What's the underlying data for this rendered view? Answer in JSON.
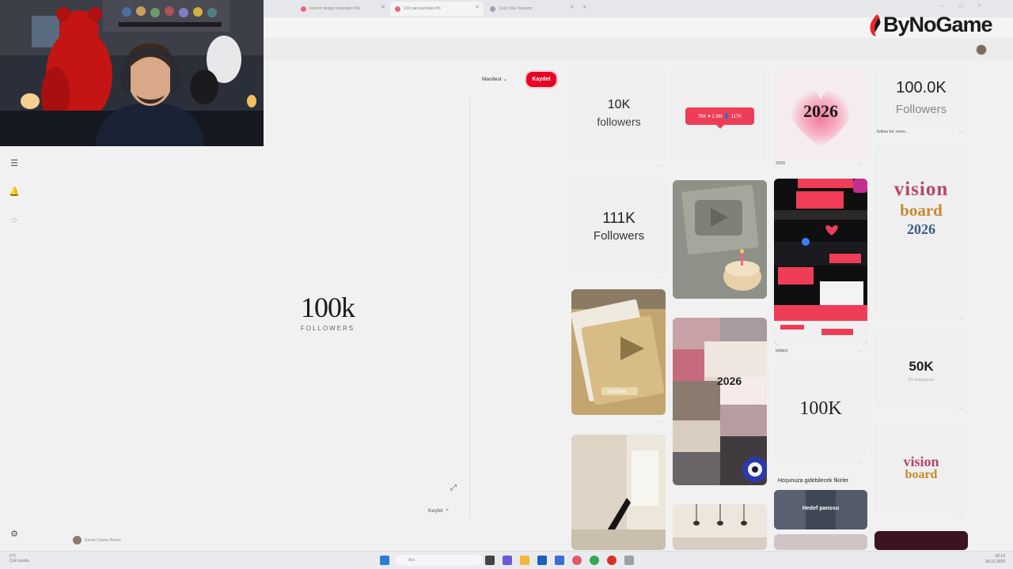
{
  "browser": {
    "tabs": [
      {
        "title": "Interior design inspiration Mo",
        "active": false,
        "icon": "pinterest-icon"
      },
      {
        "title": "100 panosundaki Pin",
        "active": true,
        "icon": "pinterest-icon"
      },
      {
        "title": "Cozy Oda Tasarımı",
        "active": false,
        "icon": "page-icon"
      }
    ],
    "new_tab": "+"
  },
  "logo": {
    "text": "ByNoGame",
    "flame_color": "#e8262b"
  },
  "pin": {
    "big_text": "100k",
    "sub_text": "FOLLOWERS",
    "board_dropdown": "Manifest ⌄",
    "save_label": "Kaydet",
    "explore_label": "Keşfet",
    "save_color": "#e60023"
  },
  "sidebar": {
    "profile_name": "Kevin Camo Perez"
  },
  "grid": {
    "card_10k": {
      "num": "10K",
      "label": "followers"
    },
    "card_badge": {
      "text": "78K ♥ 2.3M 👤 117K"
    },
    "card_2026": {
      "text": "2026",
      "caption": "2026"
    },
    "card_100k_followers": {
      "num": "100.0K",
      "label": "Followers",
      "caption": "follow for more.."
    },
    "card_111k": {
      "num": "111K",
      "label": "Followers"
    },
    "card_vision": {
      "line1": "vision",
      "line2": "board",
      "line3": "2026"
    },
    "card_collage_caption": "takipçi",
    "card_50k": {
      "num": "50K",
      "label": "On Instagram"
    },
    "card_100k_serif": {
      "text": "100K"
    },
    "section_label": "Hoşunuza gidebilecek fikirler",
    "hedef_label": "Hedef panosu",
    "card_vision2": {
      "line1": "vision",
      "line2": "board"
    },
    "youtube_label": "YouTube",
    "vision_collage_year": "2026"
  },
  "taskbar": {
    "weather_line1": "5°C",
    "weather_line2": "Çok bulutlu",
    "search_placeholder": "Ara",
    "time": "02:13",
    "date": "18.12.2025"
  }
}
